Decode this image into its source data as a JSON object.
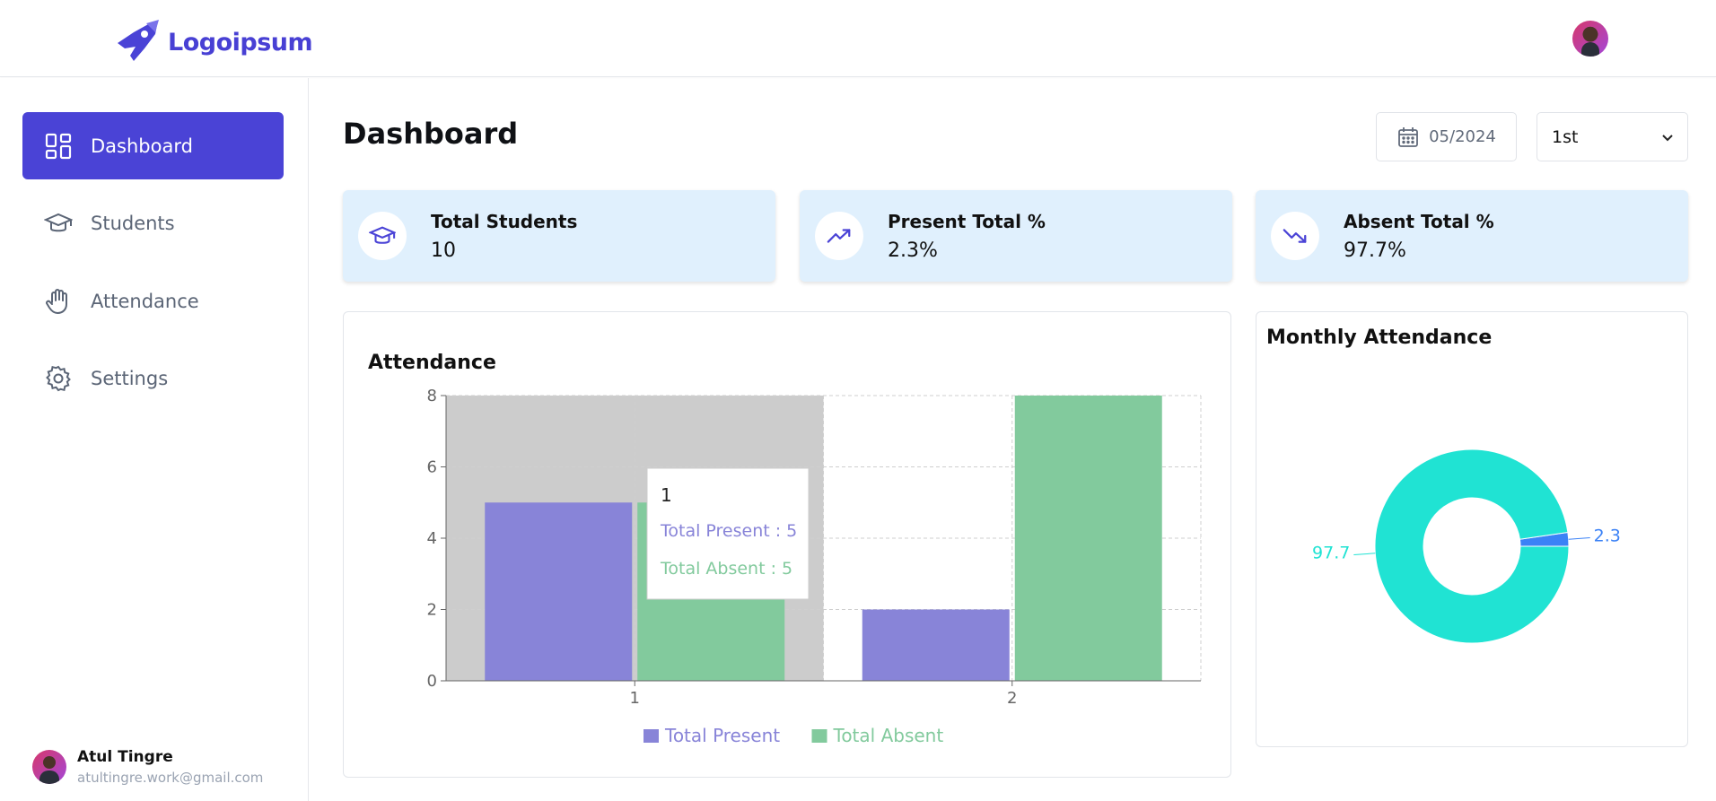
{
  "brand": {
    "name": "Logoipsum",
    "color": "#4840d4"
  },
  "sidebar": {
    "items": [
      {
        "label": "Dashboard",
        "icon": "dashboard-grid-icon",
        "active": true
      },
      {
        "label": "Students",
        "icon": "graduation-cap-icon",
        "active": false
      },
      {
        "label": "Attendance",
        "icon": "hand-icon",
        "active": false
      },
      {
        "label": "Settings",
        "icon": "gear-icon",
        "active": false
      }
    ],
    "user": {
      "name": "Atul Tingre",
      "email": "atultingre.work@gmail.com"
    }
  },
  "header": {
    "title": "Dashboard",
    "date": "05/2024",
    "period_select": "1st"
  },
  "stats": [
    {
      "title": "Total Students",
      "value": "10",
      "icon": "graduation-cap-icon"
    },
    {
      "title": "Present Total %",
      "value": "2.3%",
      "icon": "trending-up-icon"
    },
    {
      "title": "Absent Total %",
      "value": "97.7%",
      "icon": "trending-down-icon"
    }
  ],
  "colors": {
    "accent": "#4a43d6",
    "present": "#8884d8",
    "absent": "#82ca9d",
    "donut_absent": "#20e3d3",
    "donut_present": "#3b82f6",
    "card_bg": "#e0f0fd"
  },
  "attendance_panel": {
    "title": "Attendance",
    "tooltip": {
      "title": "1",
      "present_label": "Total Present : 5",
      "absent_label": "Total Absent : 5"
    }
  },
  "monthly_panel": {
    "title": "Monthly Attendance"
  },
  "chart_data": [
    {
      "type": "bar",
      "title": "Attendance",
      "categories": [
        "1",
        "2"
      ],
      "series": [
        {
          "name": "Total Present",
          "values": [
            5,
            2
          ]
        },
        {
          "name": "Total Absent",
          "values": [
            5,
            8
          ]
        }
      ],
      "ylim": [
        0,
        8
      ],
      "yticks": [
        "0",
        "2",
        "4",
        "6",
        "8"
      ],
      "grid": true,
      "legend": "bottom",
      "highlighted_category": "1"
    },
    {
      "type": "pie",
      "title": "Monthly Attendance",
      "donut": true,
      "slices": [
        {
          "label": "2.3",
          "value": 2.3
        },
        {
          "label": "97.7",
          "value": 97.7
        }
      ]
    }
  ]
}
